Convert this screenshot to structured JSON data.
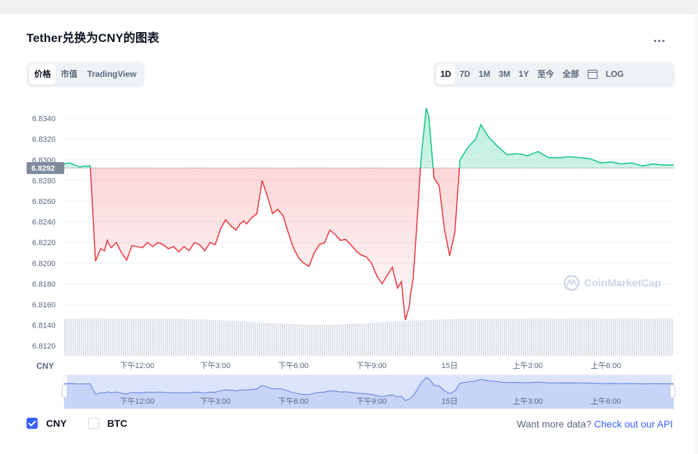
{
  "header": {
    "title": "Tether兑换为CNY的图表",
    "more_label": "..."
  },
  "chart_type_tabs": [
    {
      "label": "价格",
      "active": true
    },
    {
      "label": "市值",
      "active": false
    },
    {
      "label": "TradingView",
      "active": false
    }
  ],
  "range_tabs": [
    {
      "label": "1D",
      "active": true
    },
    {
      "label": "7D",
      "active": false
    },
    {
      "label": "1M",
      "active": false
    },
    {
      "label": "3M",
      "active": false
    },
    {
      "label": "1Y",
      "active": false
    },
    {
      "label": "至今",
      "active": false
    },
    {
      "label": "全部",
      "active": false
    }
  ],
  "calendar_icon": "calendar-icon",
  "log_label": "LOG",
  "colors": {
    "up": "#16c784",
    "down": "#ea3943",
    "accent": "#3861fb",
    "volume": "#cfd6e4",
    "navigator": "#5b7be0"
  },
  "watermark": "CoinMarketCap",
  "chart_data": {
    "type": "line",
    "title": "Tether兑换为CNY的图表",
    "y_unit_label": "CNY",
    "current_price_label": "6.8292",
    "baseline": 6.8292,
    "ylim": [
      6.811,
      6.836
    ],
    "y_ticks": [
      "6.8340",
      "6.8320",
      "6.8300",
      "6.8280",
      "6.8260",
      "6.8240",
      "6.8220",
      "6.8200",
      "6.8180",
      "6.8160",
      "6.8140",
      "6.8120"
    ],
    "y_tick_values": [
      6.834,
      6.832,
      6.83,
      6.828,
      6.826,
      6.824,
      6.822,
      6.82,
      6.818,
      6.816,
      6.814,
      6.812
    ],
    "x_ticks": [
      {
        "label": "下午12:00",
        "h": 2.8
      },
      {
        "label": "下午3:00",
        "h": 5.8
      },
      {
        "label": "下午6:00",
        "h": 8.8
      },
      {
        "label": "下午9:00",
        "h": 11.8
      },
      {
        "label": "15日",
        "h": 14.8
      },
      {
        "label": "上午3:00",
        "h": 17.8
      },
      {
        "label": "上午6:00",
        "h": 20.8
      }
    ],
    "grid": true,
    "series": [
      {
        "h": [
          0,
          0.2,
          0.4,
          0.6,
          0.8,
          1.0,
          1.2,
          1.4,
          1.55,
          1.65,
          1.8,
          2.0,
          2.2,
          2.4,
          2.6,
          2.8,
          3.0,
          3.2,
          3.4,
          3.6,
          3.8,
          4.0,
          4.2,
          4.4,
          4.6,
          4.8,
          5.0,
          5.2,
          5.4,
          5.6,
          5.8,
          6.0,
          6.2,
          6.4,
          6.6,
          6.75,
          6.9,
          7.0,
          7.2,
          7.4,
          7.6,
          7.8,
          8.0,
          8.2,
          8.4,
          8.6,
          8.8,
          9.0,
          9.2,
          9.4,
          9.6,
          9.8,
          10.0,
          10.2,
          10.4,
          10.6,
          10.8,
          11.0,
          11.2,
          11.4,
          11.6,
          11.8,
          12.0,
          12.2,
          12.4,
          12.6,
          12.8,
          12.95,
          13.1,
          13.25,
          13.3,
          13.4,
          13.55,
          13.7,
          13.9,
          14.0,
          14.2,
          14.4,
          14.6,
          14.8,
          15.0,
          15.2,
          15.5,
          15.8,
          16.0,
          16.3,
          16.6,
          17.0,
          17.4,
          17.8,
          18.2,
          18.6,
          19.0,
          19.4,
          19.8,
          20.2,
          20.6,
          21.0,
          21.4,
          21.8,
          22.2,
          22.6,
          23.0,
          23.4
        ],
        "values": [
          6.8296,
          6.8297,
          6.8295,
          6.8293,
          6.8294,
          6.8294,
          6.8202,
          6.8214,
          6.8212,
          6.8222,
          6.8215,
          6.822,
          6.821,
          6.8203,
          6.8217,
          6.8216,
          6.8215,
          6.822,
          6.8216,
          6.822,
          6.8218,
          6.8214,
          6.8216,
          6.8211,
          6.8216,
          6.8212,
          6.822,
          6.8218,
          6.8212,
          6.822,
          6.8218,
          6.8233,
          6.8242,
          6.8236,
          6.8232,
          6.8238,
          6.8241,
          6.8238,
          6.8244,
          6.8248,
          6.828,
          6.8265,
          6.8248,
          6.8252,
          6.8246,
          6.823,
          6.8215,
          6.8205,
          6.82,
          6.8197,
          6.821,
          6.8218,
          6.822,
          6.8232,
          6.8228,
          6.8222,
          6.8223,
          6.8218,
          6.8212,
          6.8208,
          6.8206,
          6.82,
          6.8188,
          6.818,
          6.8188,
          6.8196,
          6.8176,
          6.8182,
          6.8145,
          6.8158,
          6.817,
          6.8185,
          6.824,
          6.83,
          6.835,
          6.8342,
          6.8282,
          6.8275,
          6.8233,
          6.8207,
          6.823,
          6.83,
          6.8312,
          6.832,
          6.8334,
          6.8322,
          6.8314,
          6.8305,
          6.8306,
          6.8304,
          6.8308,
          6.8302,
          6.8302,
          6.8303,
          6.8302,
          6.8301,
          6.8297,
          6.8298,
          6.8296,
          6.8297,
          6.8294,
          6.8296,
          6.8295,
          6.8295
        ]
      }
    ],
    "volume_label": "成交量"
  },
  "navigator": {
    "x_ticks": [
      "下午12:00",
      "下午3:00",
      "下午6:00",
      "下午9:00",
      "15日",
      "上午3:00",
      "上午6:00"
    ]
  },
  "footer": {
    "series_toggles": [
      {
        "label": "CNY",
        "checked": true
      },
      {
        "label": "BTC",
        "checked": false
      }
    ],
    "api_prefix": "Want more data?",
    "api_link": "Check out our API"
  }
}
